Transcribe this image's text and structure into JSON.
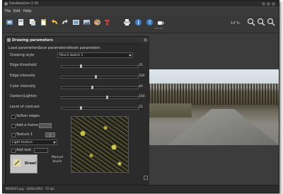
{
  "window": {
    "title": "FotoSketcher 2.70"
  },
  "menu": [
    "File",
    "Edit",
    "Help"
  ],
  "toolbar": {
    "tools": [
      {
        "icon": "open-icon",
        "label": ""
      },
      {
        "icon": "save-icon",
        "label": ""
      },
      {
        "icon": "copy-icon",
        "label": ""
      },
      {
        "icon": "paste-icon",
        "label": ""
      },
      {
        "icon": "undo-icon",
        "label": ""
      },
      {
        "icon": "redo-icon",
        "label": ""
      },
      {
        "icon": "image-icon",
        "label": ""
      },
      {
        "icon": "landscape-icon",
        "label": ""
      },
      {
        "icon": "palette-icon",
        "label": ""
      },
      {
        "icon": "text-icon",
        "label": ""
      },
      {
        "icon": "print-icon",
        "label": ""
      },
      {
        "icon": "info-icon",
        "label": ""
      },
      {
        "icon": "help-icon",
        "label": ""
      },
      {
        "icon": "coffee-icon",
        "label": "Donate"
      }
    ],
    "zoom_text": "14 %"
  },
  "drawing_panel": {
    "title": "Drawing parameters",
    "links": [
      "Load parameters",
      "Save parameters",
      "Reset parameters"
    ],
    "drawing_style_label": "Drawing style",
    "drawing_style_value": "Pencil sketch 1",
    "sliders": [
      {
        "label": "Edge threshold",
        "value": "25",
        "fraction": 0.25
      },
      {
        "label": "Edge intensity",
        "value": "100",
        "fraction": 0.45
      },
      {
        "label": "Color intensity",
        "value": "40",
        "fraction": 0.4
      },
      {
        "label": "Darken/Lighten",
        "value": "160",
        "fraction": 0.6
      },
      {
        "label": "Level of contrast",
        "value": "25",
        "fraction": 0.25
      }
    ],
    "options": {
      "soften_edges": "Soften edges",
      "add_frame": "Add a frame",
      "texture": "Texture 1",
      "texture_dropdown": "Light texture",
      "add_text": "Add text"
    },
    "draw_button": "Draw!",
    "manual_brush_line1": "Manual",
    "manual_brush_line2": "brush"
  },
  "status": {
    "text": "IMG0837.jpg - 3264x1952 - 72 dpi"
  }
}
